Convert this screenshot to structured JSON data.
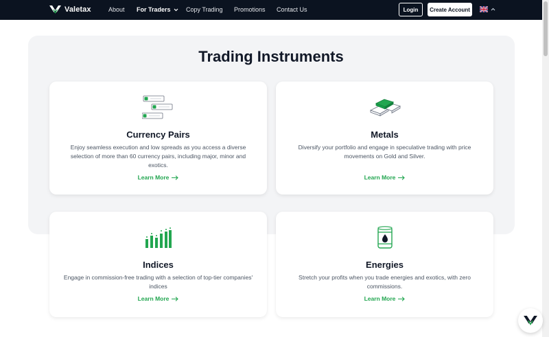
{
  "brand": {
    "name": "Valetax"
  },
  "nav": {
    "items": [
      {
        "label": "About"
      },
      {
        "label": "For Traders"
      },
      {
        "label": "Copy Trading"
      },
      {
        "label": "Promotions"
      },
      {
        "label": "Contact Us"
      }
    ],
    "login_label": "Login",
    "create_account_label": "Create Account"
  },
  "section": {
    "title": "Trading Instruments"
  },
  "cards": [
    {
      "title": "Currency Pairs",
      "description": "Enjoy seamless execution and low spreads as you access a diverse selection of more than 60 currency pairs, including major, minor and exotics.",
      "link": "Learn More",
      "icon": "currency-pairs-icon"
    },
    {
      "title": "Metals",
      "description": "Diversify your portfolio and engage in speculative trading with price movements on Gold and Silver.",
      "link": "Learn More",
      "icon": "metal-bars-icon"
    },
    {
      "title": "Indices",
      "description": "Engage in commission-free trading with a selection of top-tier companies' indices",
      "link": "Learn More",
      "icon": "indices-chart-icon"
    },
    {
      "title": "Energies",
      "description": "Stretch your profits when you trade energies and exotics, with zero commissions.",
      "link": "Learn More",
      "icon": "oil-barrel-icon"
    }
  ],
  "colors": {
    "accent": "#22a650",
    "nav_bg": "#0b1320",
    "section_bg": "#f3f4f6"
  }
}
